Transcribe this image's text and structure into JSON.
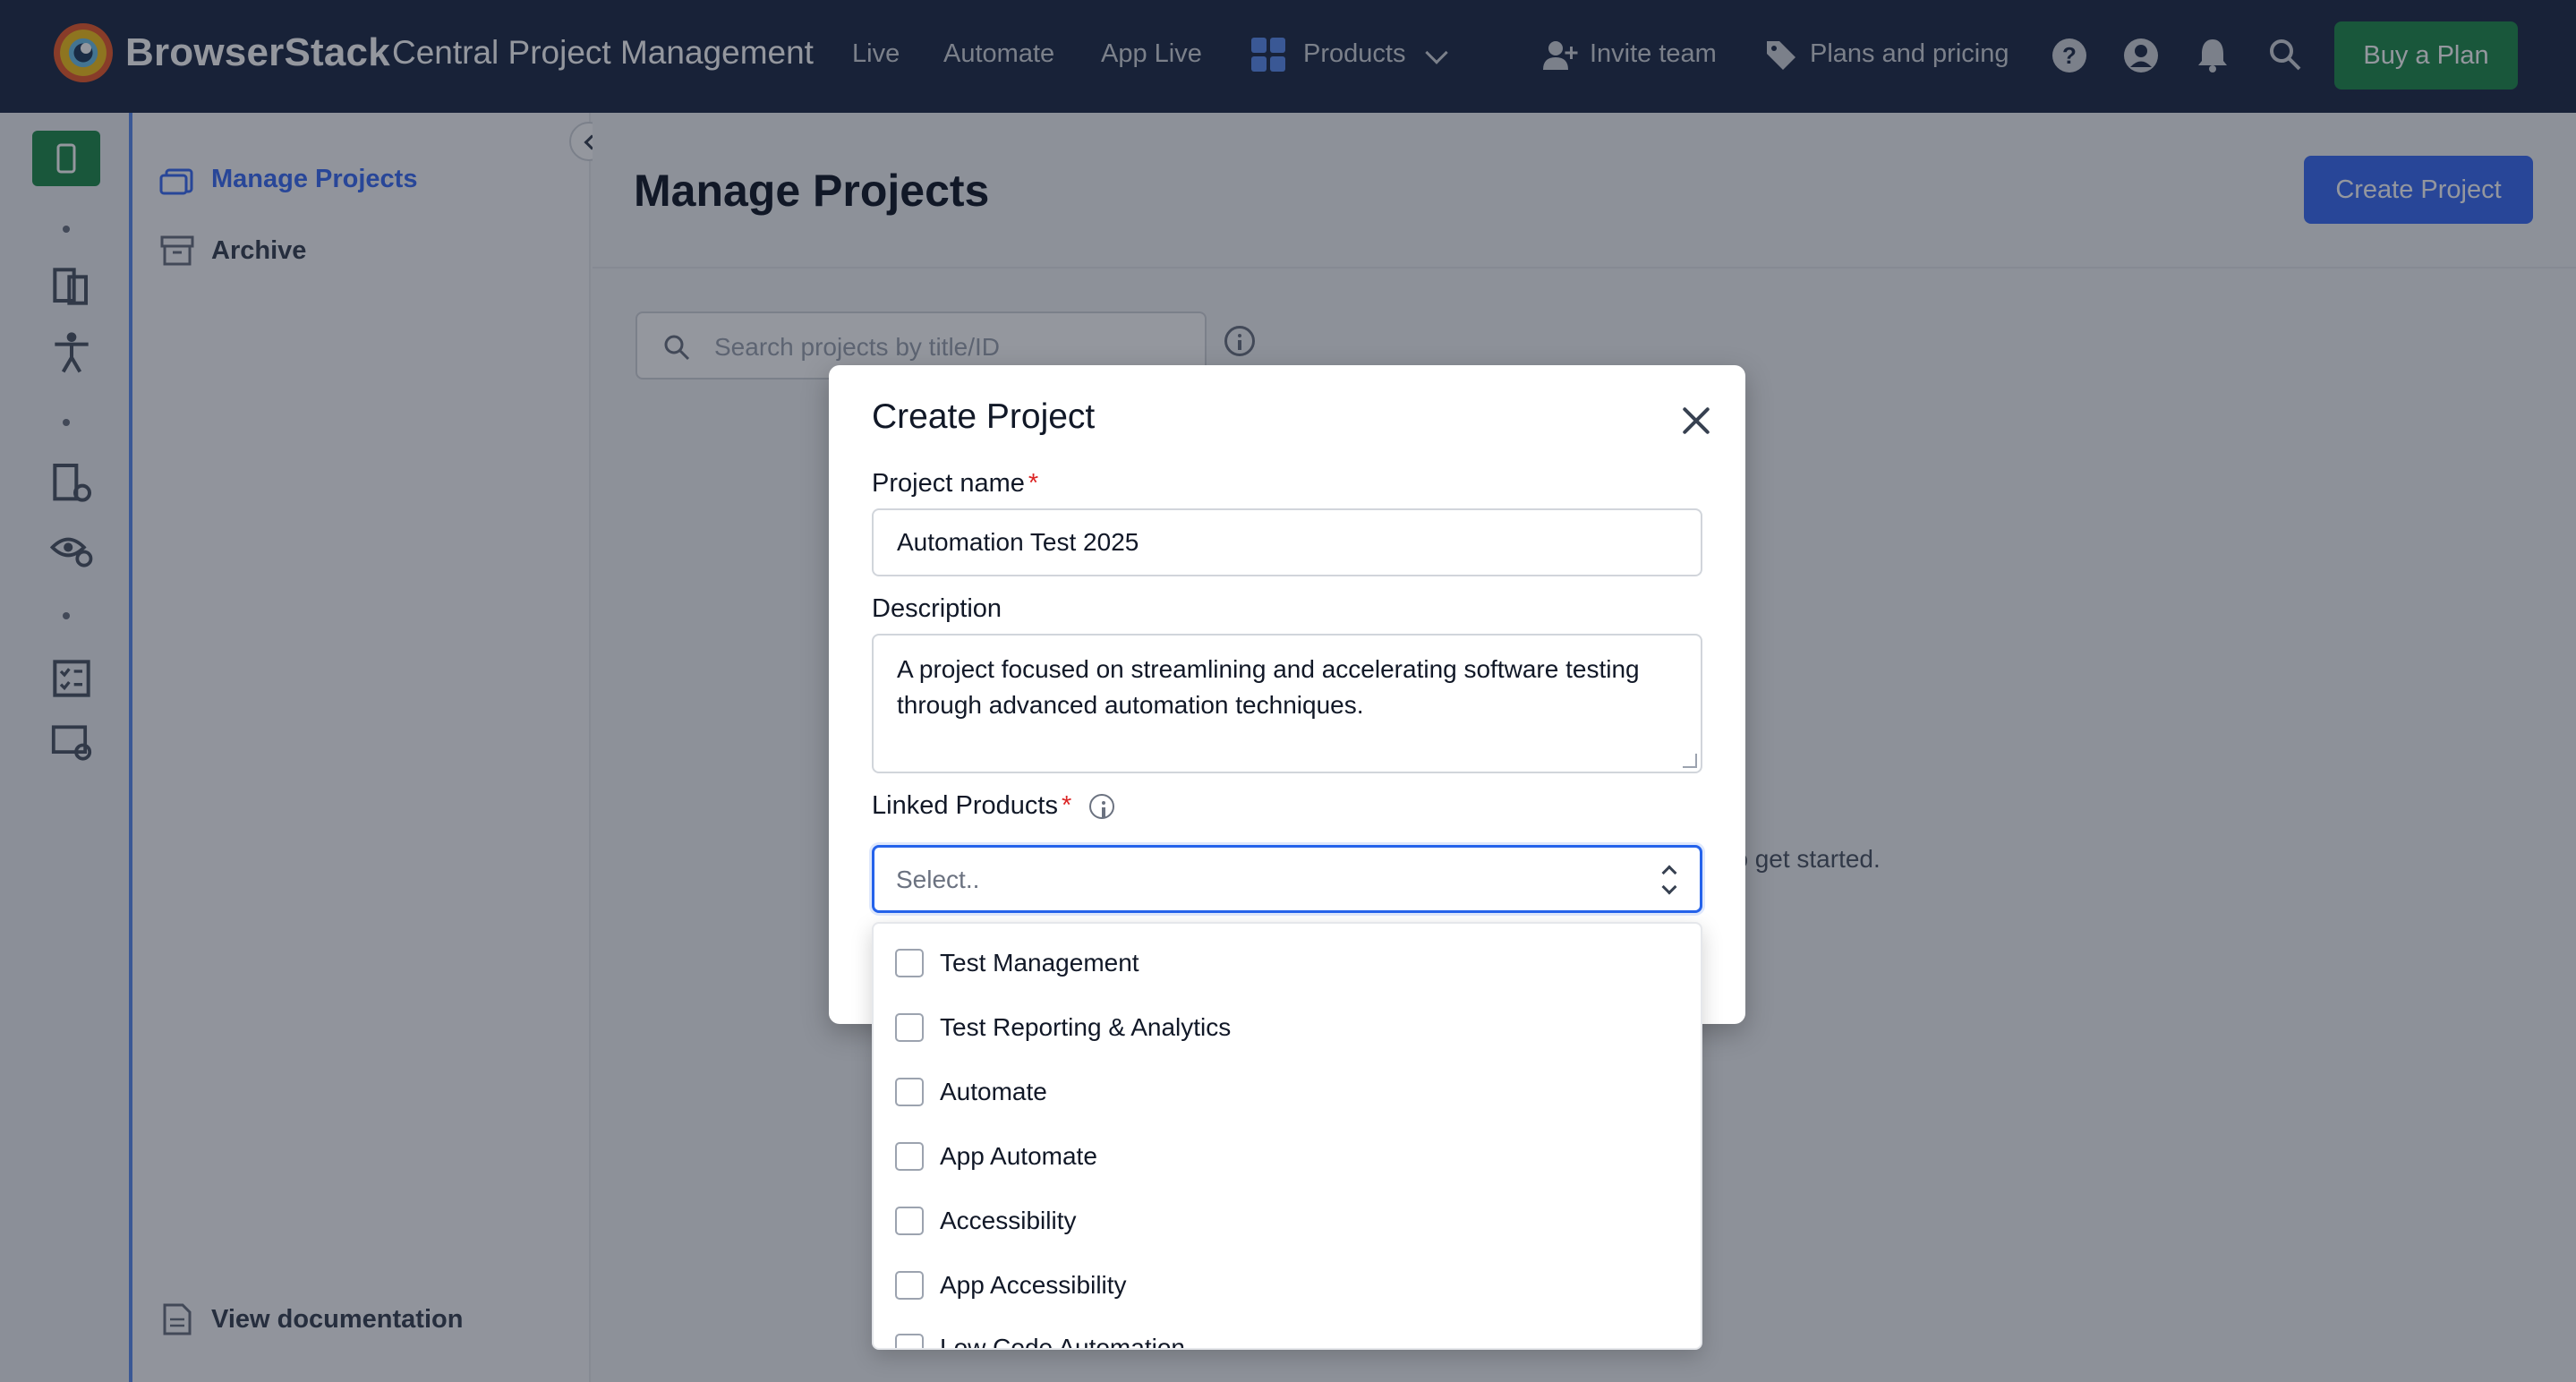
{
  "topnav": {
    "brand": "BrowserStack",
    "brand_sub": "Central Project Management",
    "links": [
      "Live",
      "Automate",
      "App Live"
    ],
    "products_label": "Products",
    "invite_label": "Invite team",
    "plans_label": "Plans and pricing",
    "buy_label": "Buy a Plan"
  },
  "subside": {
    "items": [
      {
        "label": "Manage Projects",
        "icon": "briefcase-icon",
        "active": true
      },
      {
        "label": "Archive",
        "icon": "archive-icon",
        "active": false
      }
    ],
    "footer_label": "View documentation"
  },
  "main": {
    "title": "Manage Projects",
    "create_label": "Create Project",
    "search_placeholder": "Search projects by title/ID",
    "empty_text": "ct to get started."
  },
  "modal": {
    "title": "Create Project",
    "project_name_label": "Project name",
    "project_name_value": "Automation Test 2025",
    "description_label": "Description",
    "description_value": "A project focused on streamlining and accelerating software testing through advanced automation techniques.",
    "linked_products_label": "Linked Products",
    "select_placeholder": "Select..",
    "required_mark": "*"
  },
  "dropdown": {
    "options": [
      {
        "label": "Test Management",
        "checked": false
      },
      {
        "label": "Test Reporting & Analytics",
        "checked": false
      },
      {
        "label": "Automate",
        "checked": false
      },
      {
        "label": "App Automate",
        "checked": false
      },
      {
        "label": "Accessibility",
        "checked": false
      },
      {
        "label": "App Accessibility",
        "checked": false
      },
      {
        "label": "Low Code Automation",
        "checked": false
      }
    ]
  },
  "colors": {
    "nav_bg": "#1e2b45",
    "primary": "#3b6cf5",
    "buy_green": "#1f8a4c",
    "required_red": "#dc2626"
  }
}
